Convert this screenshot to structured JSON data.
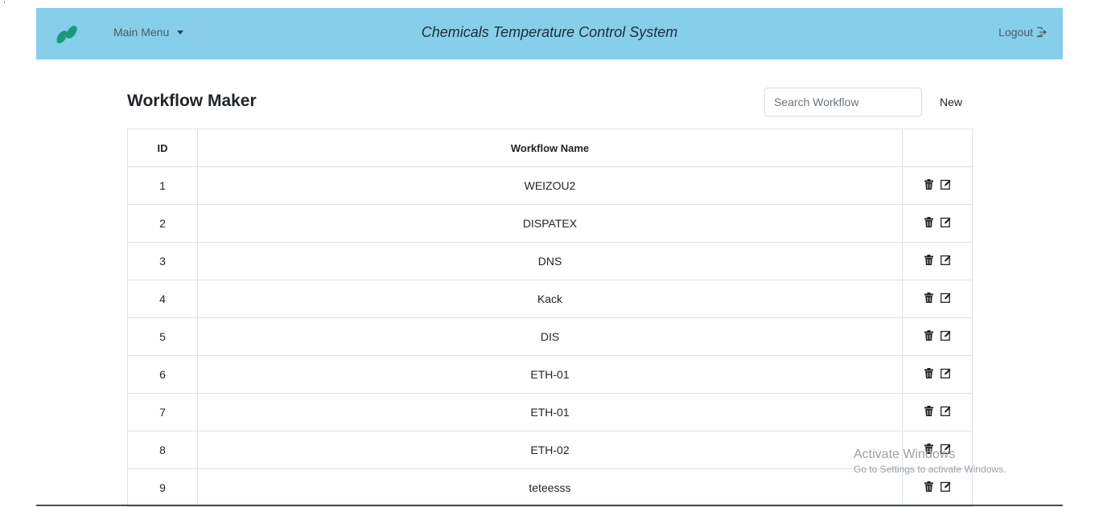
{
  "nav": {
    "menu_label": "Main Menu",
    "title": "Chemicals Temperature Control System",
    "logout_label": "Logout"
  },
  "page": {
    "title": "Workflow Maker",
    "search_placeholder": "Search Workflow",
    "new_label": "New"
  },
  "table": {
    "headers": [
      "ID",
      "Workflow Name",
      ""
    ],
    "rows": [
      {
        "id": "1",
        "name": "WEIZOU2"
      },
      {
        "id": "2",
        "name": "DISPATEX"
      },
      {
        "id": "3",
        "name": "DNS"
      },
      {
        "id": "4",
        "name": "Kack"
      },
      {
        "id": "5",
        "name": "DIS"
      },
      {
        "id": "6",
        "name": "ETH-01"
      },
      {
        "id": "7",
        "name": "ETH-01"
      },
      {
        "id": "8",
        "name": "ETH-02"
      },
      {
        "id": "9",
        "name": "teteesss"
      }
    ]
  },
  "watermark": {
    "line1": "Activate Windows",
    "line2": "Go to Settings to activate Windows."
  },
  "colors": {
    "navbar": "#87ceeb",
    "logo": "#1a9a7a"
  }
}
